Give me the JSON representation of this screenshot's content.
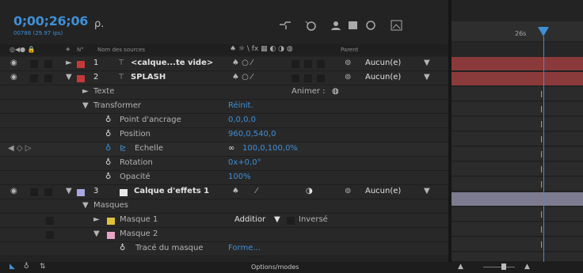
{
  "header": {
    "timecode": "0;00;26;06",
    "fps": "00786 (29.97 ips)",
    "search_placeholder": "ρ."
  },
  "columns": {
    "num": "N°",
    "source": "Nom des sources",
    "parent": "Parent"
  },
  "layers": [
    {
      "num": "1",
      "name": "<calque...te vide>",
      "parent": "Aucun(e)",
      "color": "#c33a3a"
    },
    {
      "num": "2",
      "name": "SPLASH",
      "parent": "Aucun(e)",
      "color": "#c33a3a"
    },
    {
      "num": "3",
      "name": "Calque d'effets 1",
      "parent": "Aucun(e)",
      "color": "#a9a7e0"
    }
  ],
  "props": {
    "texte": "Texte",
    "animer": "Animer :",
    "transformer": "Transformer",
    "reinit": "Réinit.",
    "ancrage": "Point d'ancrage",
    "ancrage_val": "0,0,0,0",
    "position": "Position",
    "position_val": "960,0,540,0",
    "echelle": "Echelle",
    "echelle_val": "100,0,100,0%",
    "rotation": "Rotation",
    "rotation_val": "0x+0,0°",
    "opacite": "Opacité",
    "opacite_val": "100%",
    "masques": "Masques",
    "masque1": "Masque 1",
    "masque1_mode": "Additior",
    "inverse": "Inversé",
    "masque2": "Masque 2",
    "trace": "Tracé du masque",
    "forme": "Forme..."
  },
  "timeline": {
    "ruler_label": "26s"
  },
  "bottom": {
    "toggle": "Options/modes"
  },
  "colors": {
    "accent": "#3f8fd6",
    "label_red": "#c33a3a",
    "label_yellow": "#e0c23a",
    "label_pink": "#e8a4c4",
    "label_lavender": "#a9a7e0"
  }
}
